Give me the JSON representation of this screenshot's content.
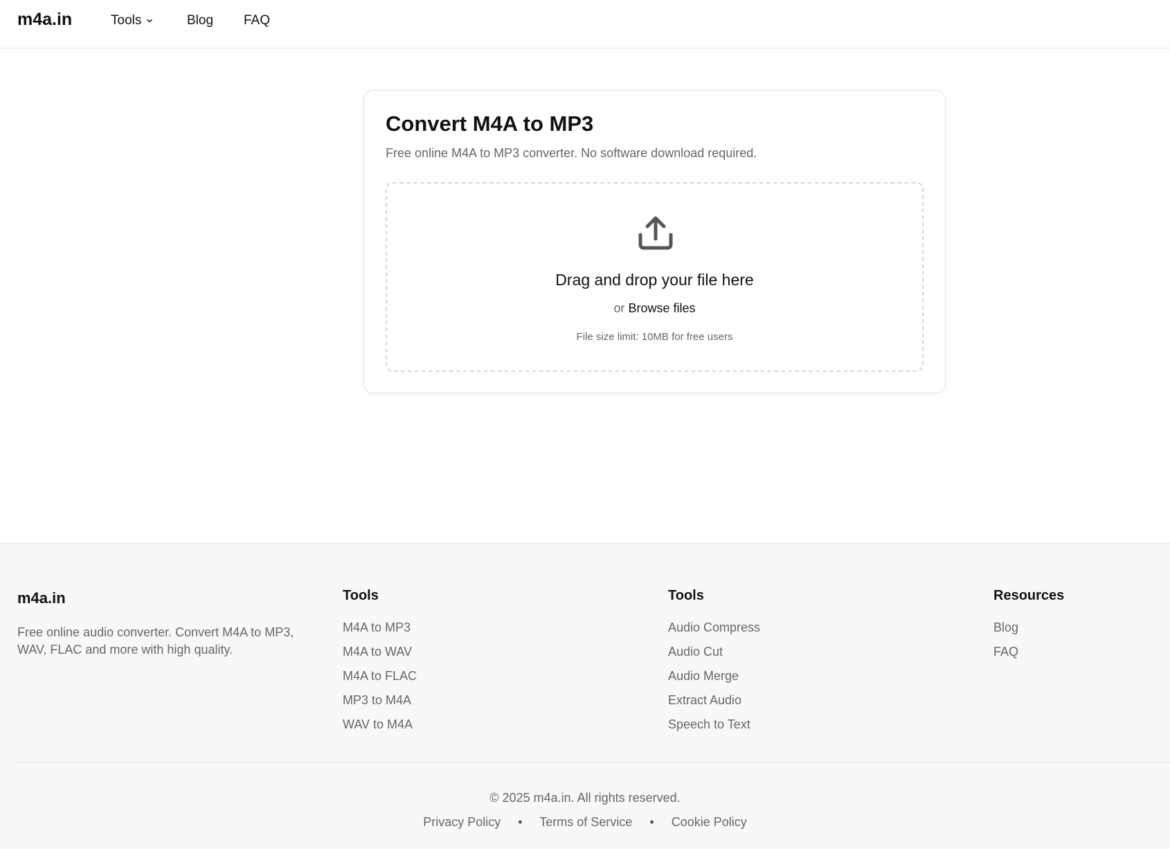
{
  "header": {
    "logo": "m4a.in",
    "nav": {
      "tools": "Tools",
      "blog": "Blog",
      "faq": "FAQ"
    }
  },
  "converter": {
    "title": "Convert M4A to MP3",
    "subtitle": "Free online M4A to MP3 converter. No software download required.",
    "drop_title": "Drag and drop your file here",
    "or_text": "or",
    "browse_label": "Browse files",
    "size_limit": "File size limit: 10MB for free users"
  },
  "footer": {
    "brand": "m4a.in",
    "description": "Free online audio converter. Convert M4A to MP3, WAV, FLAC and more with high quality.",
    "columns": [
      {
        "title": "Tools",
        "links": [
          "M4A to MP3",
          "M4A to WAV",
          "M4A to FLAC",
          "MP3 to M4A",
          "WAV to M4A"
        ]
      },
      {
        "title": "Tools",
        "links": [
          "Audio Compress",
          "Audio Cut",
          "Audio Merge",
          "Extract Audio",
          "Speech to Text"
        ]
      },
      {
        "title": "Resources",
        "links": [
          "Blog",
          "FAQ"
        ]
      }
    ],
    "copyright": "© 2025 m4a.in. All rights reserved.",
    "legal": {
      "privacy": "Privacy Policy",
      "terms": "Terms of Service",
      "cookie": "Cookie Policy",
      "separator": "•"
    }
  }
}
